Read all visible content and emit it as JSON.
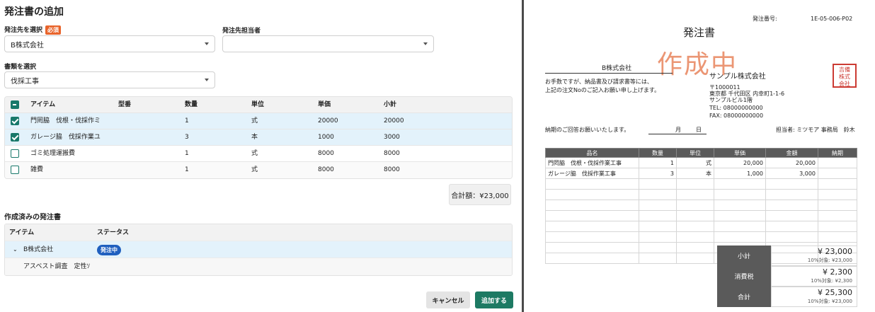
{
  "left": {
    "title": "発注書の追加",
    "vendor_label": "発注先を選択",
    "required_badge": "必須",
    "vendor_value": "B株式会社",
    "contact_label": "発注先担当者",
    "contact_value": "",
    "doctype_label": "書類を選択",
    "doctype_value": "伐採工事",
    "items_table": {
      "headers": [
        "アイテム",
        "型番",
        "数量",
        "単位",
        "単価",
        "小計"
      ],
      "rows": [
        {
          "checked": true,
          "item": "門罔脇　伐根・伐採作ミ",
          "model": "",
          "qty": "1",
          "unit": "式",
          "price": "20000",
          "subtotal": "20000"
        },
        {
          "checked": true,
          "item": "ガレージ脇　伐採作業ユ",
          "model": "",
          "qty": "3",
          "unit": "本",
          "price": "1000",
          "subtotal": "3000"
        },
        {
          "checked": false,
          "item": "ゴミ処理運搬費",
          "model": "",
          "qty": "1",
          "unit": "式",
          "price": "8000",
          "subtotal": "8000"
        },
        {
          "checked": false,
          "item": "雑費",
          "model": "",
          "qty": "1",
          "unit": "式",
          "price": "8000",
          "subtotal": "8000"
        }
      ]
    },
    "total_text": "合計額：¥23,000",
    "created_section_title": "作成済みの発注書",
    "created_table": {
      "headers": [
        "アイテム",
        "ステータス"
      ],
      "group_label": "B株式会社",
      "status_badge": "発注中",
      "sub_item": "アスベスト調査　定性ｿ"
    },
    "cancel_label": "キャンセル",
    "add_label": "追加する"
  },
  "doc": {
    "number_label": "発注番号:",
    "number_value": "1E-05-006-P02",
    "title": "発注書",
    "stamp": "作成中",
    "recipient": "B株式会社",
    "greeting_1": "お手数ですが、納品書及び請求書等には、",
    "greeting_2": "上記の注文Noのご記入お願い申し上げます。",
    "company": "サンプル株式会社",
    "addr_1": "〒1000011",
    "addr_2": "東京都 千代田区 内幸町1-1-6",
    "addr_3": "サンプルビル1階",
    "tel": "TEL: 08000000000",
    "fax": "FAX: 08000000000",
    "seal_text": "吉備株式会社印",
    "deadline_label": "納期のご回答お願いいたします。",
    "month_label": "月",
    "day_label": "日",
    "person": "担当者: ミツモア 事務局　鈴木",
    "table_headers": [
      "品名",
      "数量",
      "単位",
      "単価",
      "金額",
      "納期"
    ],
    "table_rows": [
      {
        "name": "門罔脇　伐根・伐採作業工事",
        "qty": "1",
        "unit": "式",
        "price": "20,000",
        "amount": "20,000",
        "due": ""
      },
      {
        "name": "ガレージ脇　伐採作業工事",
        "qty": "3",
        "unit": "本",
        "price": "1,000",
        "amount": "3,000",
        "due": ""
      }
    ],
    "subtotal_label": "小計",
    "subtotal_value": "¥ 23,000",
    "subtotal_sub": "10%対象: ¥23,000",
    "tax_label": "消費税",
    "tax_value": "¥ 2,300",
    "tax_sub": "10%対象: ¥2,300",
    "total_label": "合計",
    "total_value": "¥ 25,300",
    "total_sub": "10%対象: ¥23,000"
  },
  "colors": {
    "accent": "#1d7a63",
    "badge_blue": "#1f5fbf",
    "required": "#e8642b",
    "stamp": "#e8845c"
  }
}
